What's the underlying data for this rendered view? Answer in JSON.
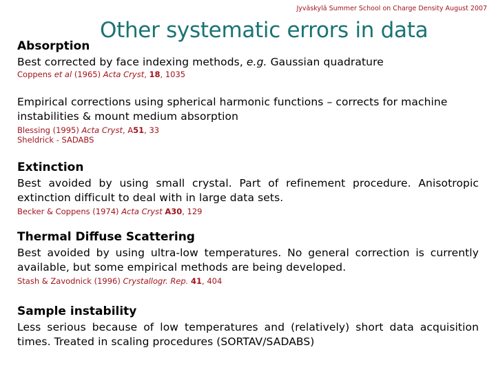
{
  "header": {
    "note": "Jyväskylä Summer School  on Charge Density August 2007",
    "title": "Other systematic errors in data"
  },
  "colors": {
    "title": "#1a7373",
    "reference": "#a0141e",
    "text": "#000000"
  },
  "sections": [
    {
      "heading": "Absorption",
      "paragraphs": [
        {
          "text_before": "Best corrected by face indexing methods, ",
          "text_italic": "e.g.",
          "text_after": " Gaussian quadrature",
          "reference": {
            "authors": "Coppens ",
            "authors_italic": "et al",
            "year": " (1965) ",
            "journal": "Acta Cryst",
            "sep1": ", ",
            "volume": "18",
            "pages": ", 1035"
          }
        },
        {
          "text": "Empirical corrections using spherical harmonic functions – corrects for machine instabilities & mount medium absorption",
          "reference": {
            "authors": "Blessing (1995) ",
            "journal": "Acta Cryst",
            "sep1": ", A",
            "volume": "51",
            "pages": ", 33"
          },
          "reference2": "Sheldrick - SADABS"
        }
      ]
    },
    {
      "heading": "Extinction",
      "text": "Best avoided by using small crystal. Part of refinement procedure. Anisotropic extinction difficult to deal with in large data sets.",
      "reference": {
        "authors": "Becker & Coppens (1974) ",
        "journal": "Acta Cryst",
        "volume": "A30",
        "pages": ",  129"
      }
    },
    {
      "heading": "Thermal Diffuse Scattering",
      "text": "Best avoided by using ultra-low temperatures. No general correction is currently available, but some empirical methods are being developed.",
      "reference": {
        "authors": "Stash & Zavodnick (1996) ",
        "journal": "Crystallogr. Rep.",
        "volume": "41",
        "pages": ",  404"
      }
    },
    {
      "heading": "Sample instability",
      "text": "Less serious because of low temperatures and (relatively) short data acquisition times. Treated in scaling procedures (SORTAV/SADABS)"
    }
  ]
}
